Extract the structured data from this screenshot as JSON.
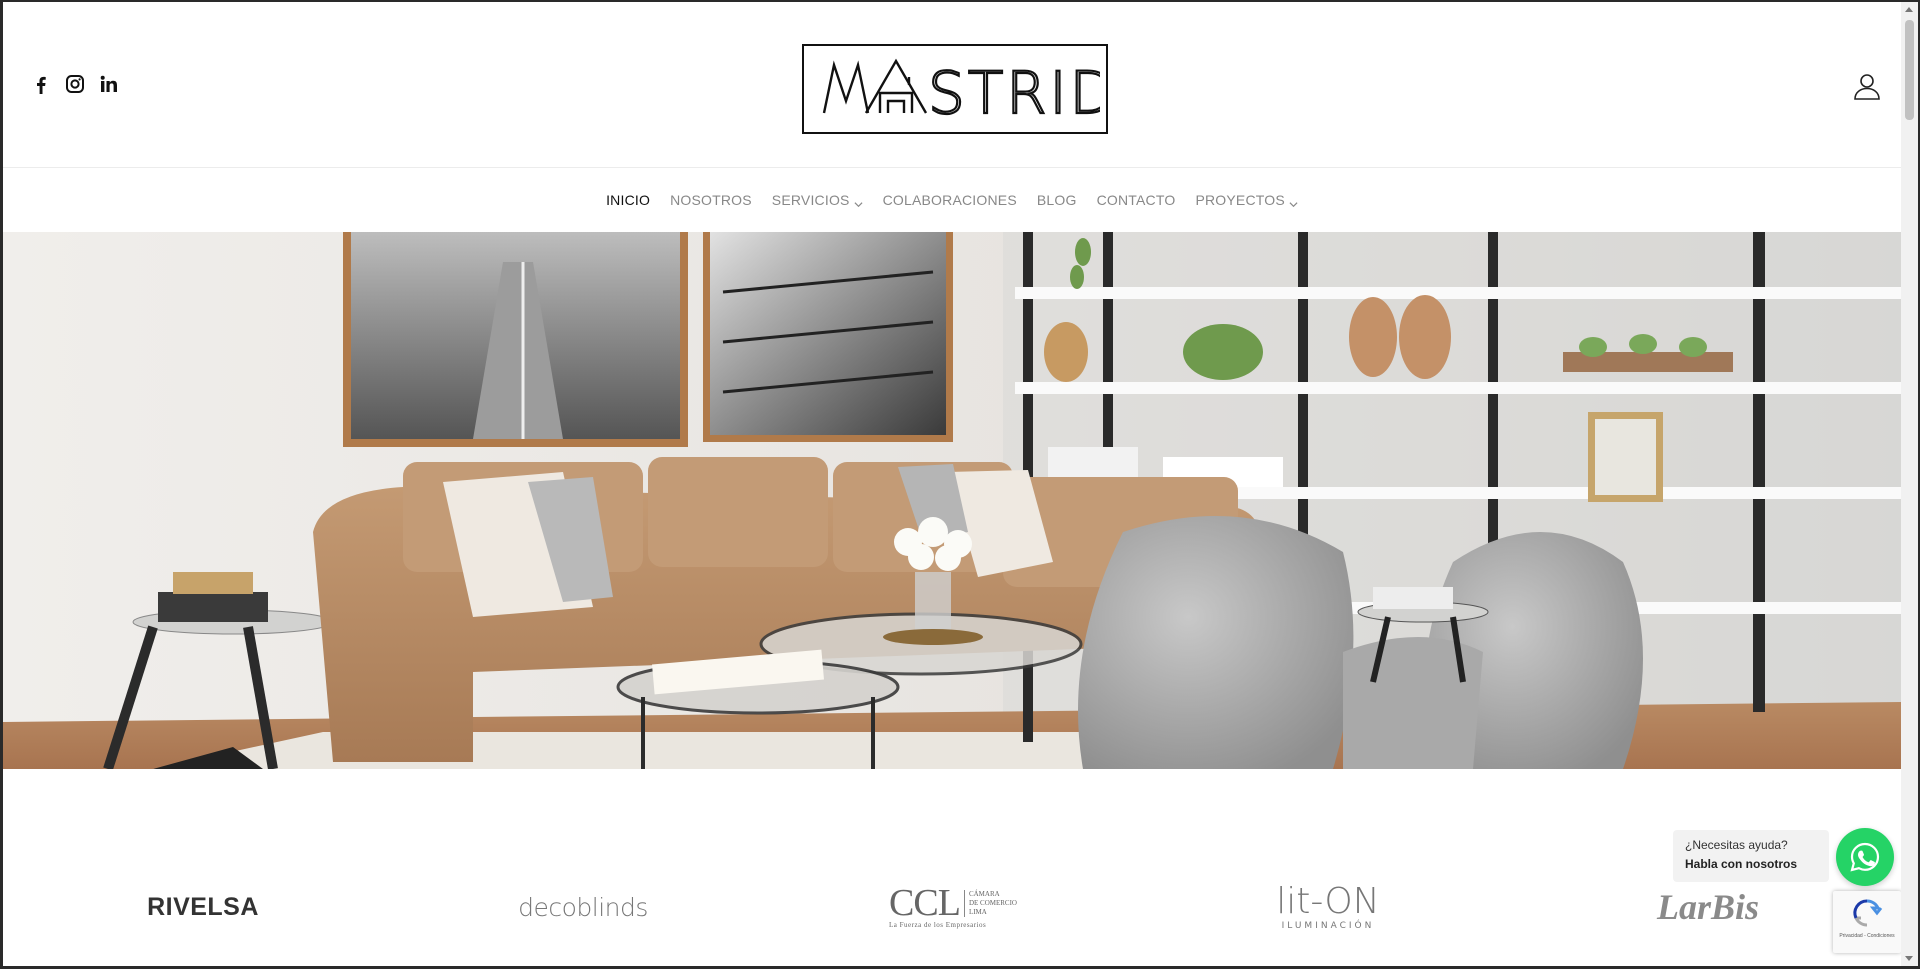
{
  "header": {
    "social": [
      {
        "name": "facebook-icon",
        "glyph": "f"
      },
      {
        "name": "instagram-icon",
        "glyph": "ig"
      },
      {
        "name": "linkedin-icon",
        "glyph": "in"
      }
    ],
    "logo_text": "MASTRID"
  },
  "nav": {
    "items": [
      {
        "label": "INICIO",
        "active": true,
        "dropdown": false
      },
      {
        "label": "NOSOTROS",
        "active": false,
        "dropdown": false
      },
      {
        "label": "SERVICIOS",
        "active": false,
        "dropdown": true
      },
      {
        "label": "COLABORACIONES",
        "active": false,
        "dropdown": false
      },
      {
        "label": "BLOG",
        "active": false,
        "dropdown": false
      },
      {
        "label": "CONTACTO",
        "active": false,
        "dropdown": false
      },
      {
        "label": "PROYECTOS",
        "active": false,
        "dropdown": true
      }
    ]
  },
  "brands": {
    "items": [
      {
        "name": "RIVELSA"
      },
      {
        "name": "decoblinds"
      },
      {
        "name": "CCL",
        "sub1": "CÁMARA",
        "sub2": "DE COMERCIO",
        "sub3": "LIMA",
        "tagline": "La Fuerza de los Empresarios"
      },
      {
        "name": "lit-ON",
        "sub": "ILUMINACIÓN"
      },
      {
        "name": "LarBis"
      }
    ]
  },
  "whatsapp": {
    "line1": "¿Necesitas ayuda?",
    "line2": "Habla con nosotros",
    "color": "#25d366"
  },
  "recaptcha": {
    "caption": "Privacidad - Condiciones"
  }
}
